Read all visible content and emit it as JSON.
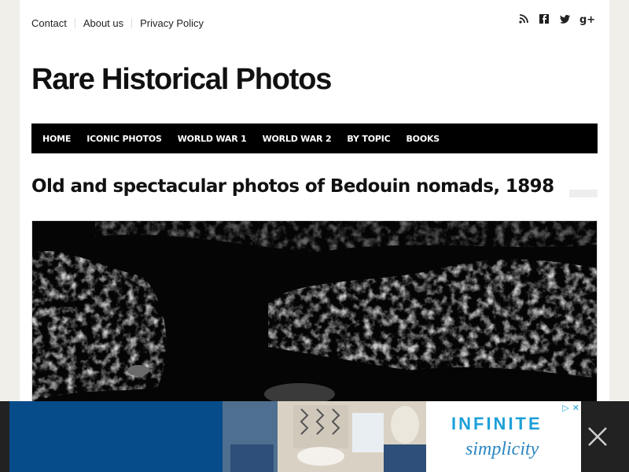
{
  "topbar": {
    "links": [
      "Contact",
      "About us",
      "Privacy Policy"
    ]
  },
  "social_icons": [
    "rss-icon",
    "facebook-icon",
    "twitter-icon",
    "google-plus-icon"
  ],
  "site": {
    "title": "Rare Historical Photos"
  },
  "nav": {
    "items": [
      "HOME",
      "ICONIC PHOTOS",
      "WORLD WAR 1",
      "WORLD WAR 2",
      "BY TOPIC",
      "BOOKS"
    ]
  },
  "article": {
    "title": "Old and spectacular photos of Bedouin nomads, 1898"
  },
  "ad": {
    "headline": "INFINITE",
    "tagline": "simplicity",
    "colors": {
      "blue_panel": "#064b8a",
      "brand": "#1da0d8"
    }
  }
}
